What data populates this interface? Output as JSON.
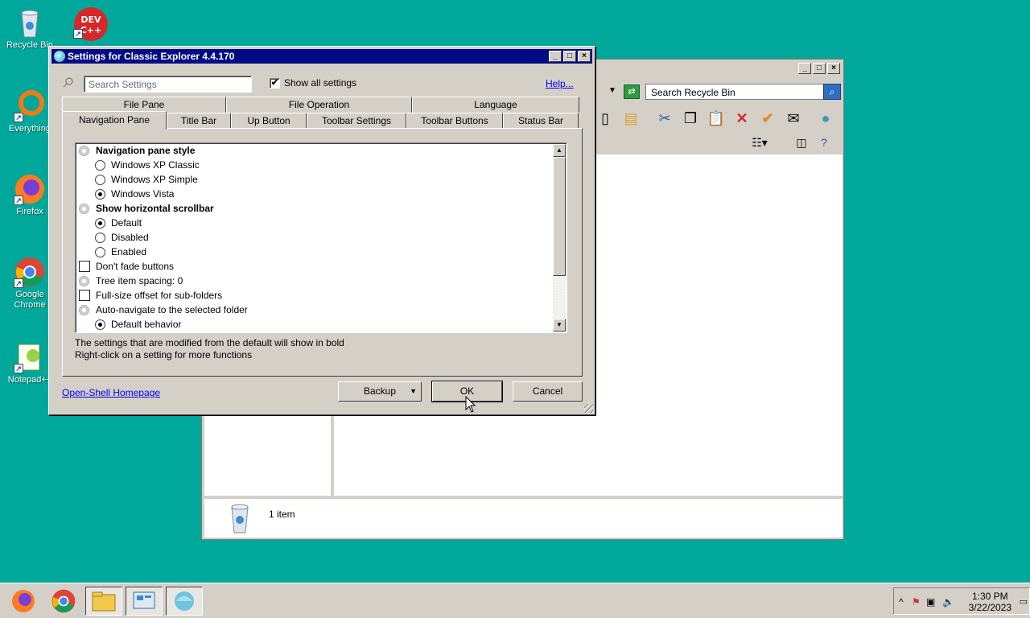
{
  "desktop": {
    "icons": [
      {
        "label": "Recycle Bin"
      },
      {
        "label": "Everything"
      },
      {
        "label": "Firefox"
      },
      {
        "label": "Google Chrome"
      },
      {
        "label": "Notepad++"
      },
      {
        "label": "DEV C++"
      }
    ]
  },
  "explorer": {
    "search_placeholder": "Search Recycle Bin",
    "status_count": "1 item"
  },
  "dialog": {
    "title": "Settings for Classic Explorer 4.4.170",
    "search_placeholder": "Search Settings",
    "show_all_label": "Show all settings",
    "show_all_checked": "✔",
    "help_label": "Help...",
    "tabs_row1": [
      "File Pane",
      "File Operation",
      "Language"
    ],
    "tabs_row2": [
      "Navigation Pane",
      "Title Bar",
      "Up Button",
      "Toolbar Settings",
      "Toolbar Buttons",
      "Status Bar"
    ],
    "active_tab": "Navigation Pane",
    "settings": [
      {
        "type": "group",
        "label": "Navigation pane style",
        "bold": true
      },
      {
        "type": "radio",
        "label": "Windows XP Classic",
        "checked": false
      },
      {
        "type": "radio",
        "label": "Windows XP Simple",
        "checked": false
      },
      {
        "type": "radio",
        "label": "Windows Vista",
        "checked": true
      },
      {
        "type": "group",
        "label": "Show horizontal scrollbar",
        "bold": true
      },
      {
        "type": "radio",
        "label": "Default",
        "checked": true
      },
      {
        "type": "radio",
        "label": "Disabled",
        "checked": false
      },
      {
        "type": "radio",
        "label": "Enabled",
        "checked": false
      },
      {
        "type": "check",
        "label": "Don't fade buttons",
        "checked": false
      },
      {
        "type": "group",
        "label": "Tree item spacing: 0",
        "bold": false
      },
      {
        "type": "check",
        "label": "Full-size offset for sub-folders",
        "checked": false
      },
      {
        "type": "group",
        "label": "Auto-navigate to the selected folder",
        "bold": false
      },
      {
        "type": "radio",
        "label": "Default behavior",
        "checked": true
      }
    ],
    "info_line1": "The settings that are modified from the default will show in bold",
    "info_line2": "Right-click on a setting for more functions",
    "homepage_label": "Open-Shell Homepage",
    "backup_label": "Backup",
    "ok_label": "OK",
    "cancel_label": "Cancel"
  },
  "taskbar": {
    "time": "1:30 PM",
    "date": "3/22/2023"
  }
}
